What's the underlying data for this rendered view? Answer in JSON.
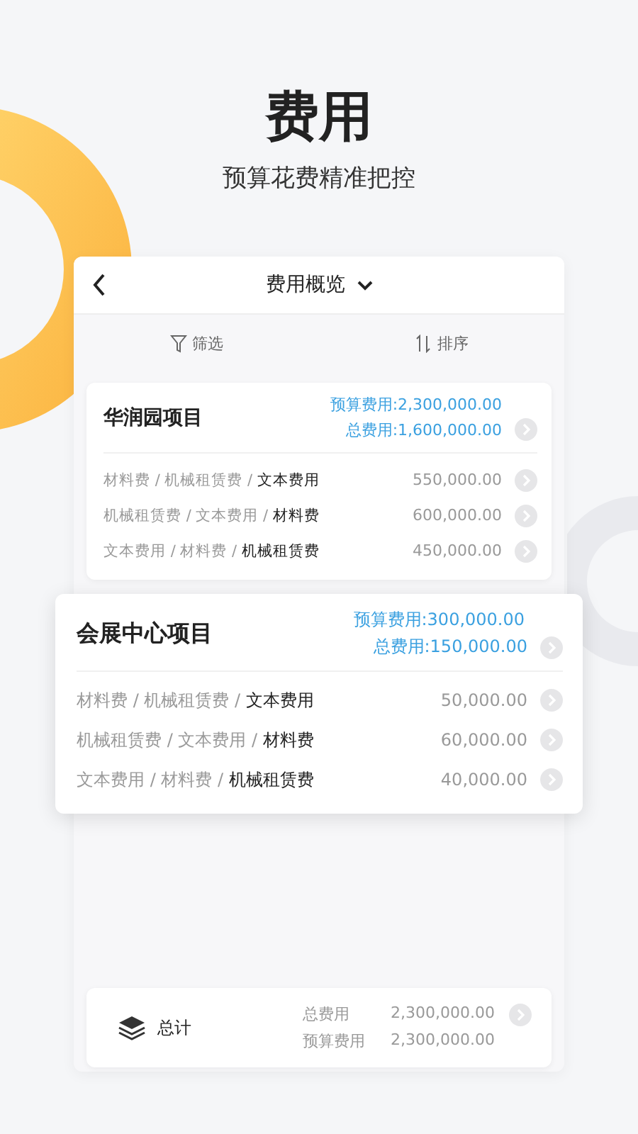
{
  "hero": {
    "title": "费用",
    "subtitle": "预算花费精准把控"
  },
  "header": {
    "title": "费用概览"
  },
  "toolbar": [
    {
      "label": "筛选",
      "kind": "filter"
    },
    {
      "label": "排序",
      "kind": "sort"
    }
  ],
  "projects": [
    {
      "name": "华润园项目",
      "raised": false,
      "budget": "预算费用:2,300,000.00",
      "total": "总费用:1,600,000.00",
      "rows": [
        {
          "path": "材料费 / 机械租赁费 / **文本费用**",
          "amount": "550,000.00"
        },
        {
          "path": "机械租赁费 / 文本费用 / **材料费**",
          "amount": "600,000.00"
        },
        {
          "path": "文本费用 / 材料费 / **机械租赁费**",
          "amount": "450,000.00"
        }
      ]
    },
    {
      "name": "会展中心项目",
      "raised": true,
      "budget": "预算费用:300,000.00",
      "total": "总费用:150,000.00",
      "rows": [
        {
          "path": "材料费 / 机械租赁费 / **文本费用**",
          "amount": "50,000.00"
        },
        {
          "path": "机械租赁费 / 文本费用 / **材料费**",
          "amount": "60,000.00"
        },
        {
          "path": "文本费用 / 材料费 / **机械租赁费**",
          "amount": "40,000.00"
        }
      ]
    }
  ],
  "summary": {
    "label": "总计",
    "lines": [
      {
        "label": "总费用",
        "value": "2,300,000.00"
      },
      {
        "label": "预算费用",
        "value": "2,300,000.00"
      }
    ]
  }
}
